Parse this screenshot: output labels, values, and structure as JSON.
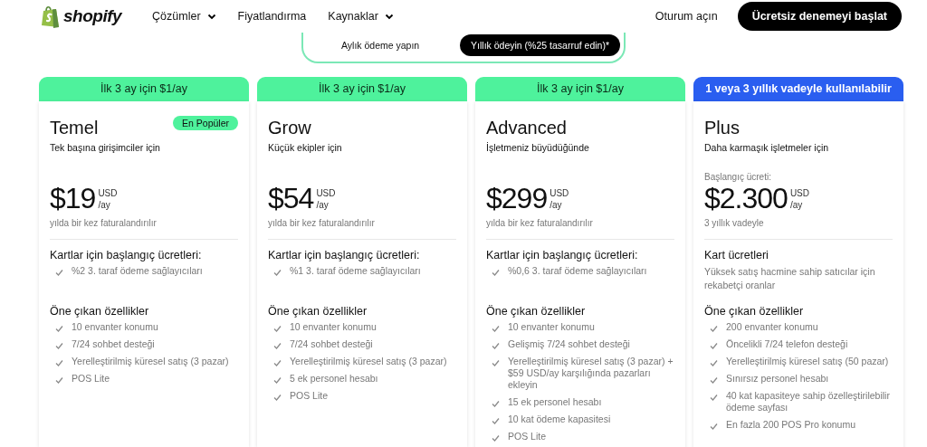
{
  "header": {
    "logo": "shopify",
    "nav": [
      {
        "label": "Çözümler",
        "dropdown": true
      },
      {
        "label": "Fiyatlandırma",
        "dropdown": false
      },
      {
        "label": "Kaynaklar",
        "dropdown": true
      }
    ],
    "login": "Oturum açın",
    "cta": "Ücretsiz denemeyi başlat"
  },
  "billing_toggle": [
    {
      "label": "Aylık ödeme yapın",
      "selected": false
    },
    {
      "label": "Yıllık ödeyin (%25 tasarruf edin)*",
      "selected": true
    }
  ],
  "plans": [
    {
      "banner": "İlk 3 ay için $1/ay",
      "color": "#4ef29c",
      "name": "Temel",
      "badge": "En Popüler",
      "tagline": "Tek başına girişimciler için",
      "price": "$19",
      "currency": "USD",
      "period": "/ay",
      "billing": "yılda bir kez faturalandırılır",
      "fees_title": "Kartlar için başlangıç ücretleri:",
      "fees": [
        "%2 3. taraf ödeme sağlayıcıları"
      ],
      "features_title": "Öne çıkan özellikler",
      "features": [
        "10 envanter konumu",
        "7/24 sohbet desteği",
        "Yerelleştirilmiş küresel satış (3 pazar)",
        "POS Lite"
      ]
    },
    {
      "banner": "İlk 3 ay için $1/ay",
      "color": "#4ef29c",
      "name": "Grow",
      "tagline": "Küçük ekipler için",
      "price": "$54",
      "currency": "USD",
      "period": "/ay",
      "billing": "yılda bir kez faturalandırılır",
      "fees_title": "Kartlar için başlangıç ücretleri:",
      "fees": [
        "%1 3. taraf ödeme sağlayıcıları"
      ],
      "features_title": "Öne çıkan özellikler",
      "features": [
        "10 envanter konumu",
        "7/24 sohbet desteği",
        "Yerelleştirilmiş küresel satış (3 pazar)",
        "5 ek personel hesabı",
        "POS Lite"
      ]
    },
    {
      "banner": "İlk 3 ay için $1/ay",
      "color": "#4ef29c",
      "name": "Advanced",
      "tagline": "İşletmeniz büyüdüğünde",
      "price": "$299",
      "currency": "USD",
      "period": "/ay",
      "billing": "yılda bir kez faturalandırılır",
      "fees_title": "Kartlar için başlangıç ücretleri:",
      "fees": [
        "%0,6 3. taraf ödeme sağlayıcıları"
      ],
      "features_title": "Öne çıkan özellikler",
      "features": [
        "10 envanter konumu",
        "Gelişmiş 7/24 sohbet desteği",
        "Yerelleştirilmiş küresel satış (3 pazar) + $59 USD/ay karşılığında pazarları ekleyin",
        "15 ek personel hesabı",
        "10 kat ödeme kapasitesi",
        "POS Lite"
      ]
    },
    {
      "banner": "1 veya 3 yıllık vadeyle kullanılabilir",
      "color": "#2a5ef0",
      "name": "Plus",
      "tagline": "Daha karmaşık işletmeler için",
      "price_prefix": "Başlangıç ücreti:",
      "price": "$2.300",
      "currency": "USD",
      "period": "/ay",
      "billing": "3 yıllık vadeyle",
      "fees_title": "Kart ücretleri",
      "fees_note": "Yüksek satış hacmine sahip satıcılar için rekabetçi oranlar",
      "features_title": "Öne çıkan özellikler",
      "features": [
        "200 envanter konumu",
        "Öncelikli 7/24 telefon desteği",
        "Yerelleştirilmiş küresel satış (50 pazar)",
        "Sınırsız personel hesabı",
        "40 kat kapasiteye sahip özelleştirilebilir ödeme sayfası",
        "En fazla 200 POS Pro konumu"
      ]
    }
  ]
}
